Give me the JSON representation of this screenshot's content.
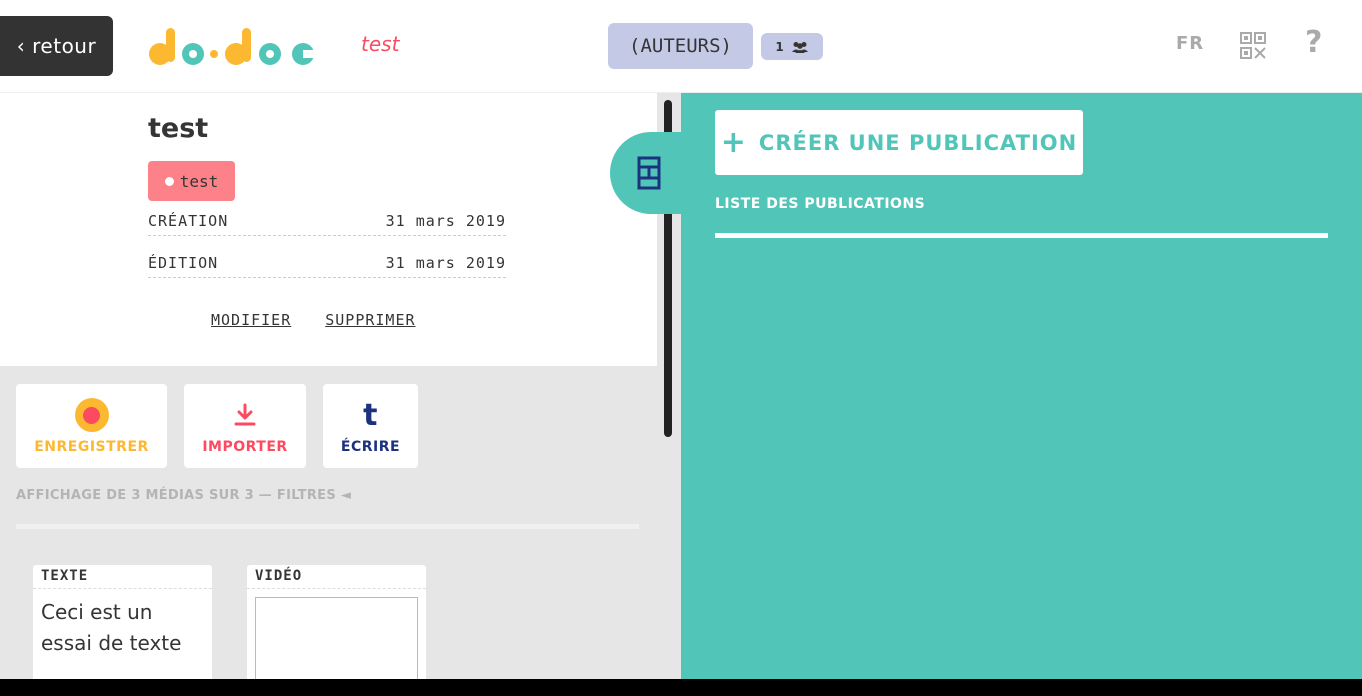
{
  "topbar": {
    "back_label": "‹ retour",
    "project_name": "test",
    "authors_label": "(AUTEURS)",
    "authors_count": "1",
    "lang": "FR",
    "help": "?"
  },
  "meta": {
    "title": "test",
    "keyword": "test",
    "created_label": "CRÉATION",
    "created_value": "31 mars 2019",
    "edited_label": "ÉDITION",
    "edited_value": "31 mars 2019",
    "edit_action": "MODIFIER",
    "delete_action": "SUPPRIMER"
  },
  "actions": {
    "record": "ENREGISTRER",
    "import": "IMPORTER",
    "write": "ÉCRIRE",
    "write_glyph": "t"
  },
  "media": {
    "filter_text": "AFFICHAGE DE 3 MÉDIAS SUR 3 — FILTRES ◄",
    "items": [
      {
        "type": "TEXTE",
        "content": "Ceci est un essai de texte"
      },
      {
        "type": "VIDÉO"
      }
    ]
  },
  "publications": {
    "create_label": "CRÉER UNE PUBLICATION",
    "list_title": "LISTE DES PUBLICATIONS"
  },
  "colors": {
    "accent_teal": "#52c5b9",
    "accent_red": "#fc4b60",
    "accent_yellow": "#fcb830",
    "accent_navy": "#1d327f",
    "authors_bg": "#c4c9e6"
  },
  "icons": {
    "back": "chevron-left-icon",
    "authors": "people-icon",
    "qr": "qr-code-icon",
    "help": "help-icon",
    "record": "record-icon",
    "import": "download-icon",
    "write": "text-icon",
    "panel_toggle": "layout-icon",
    "create": "plus-icon"
  }
}
